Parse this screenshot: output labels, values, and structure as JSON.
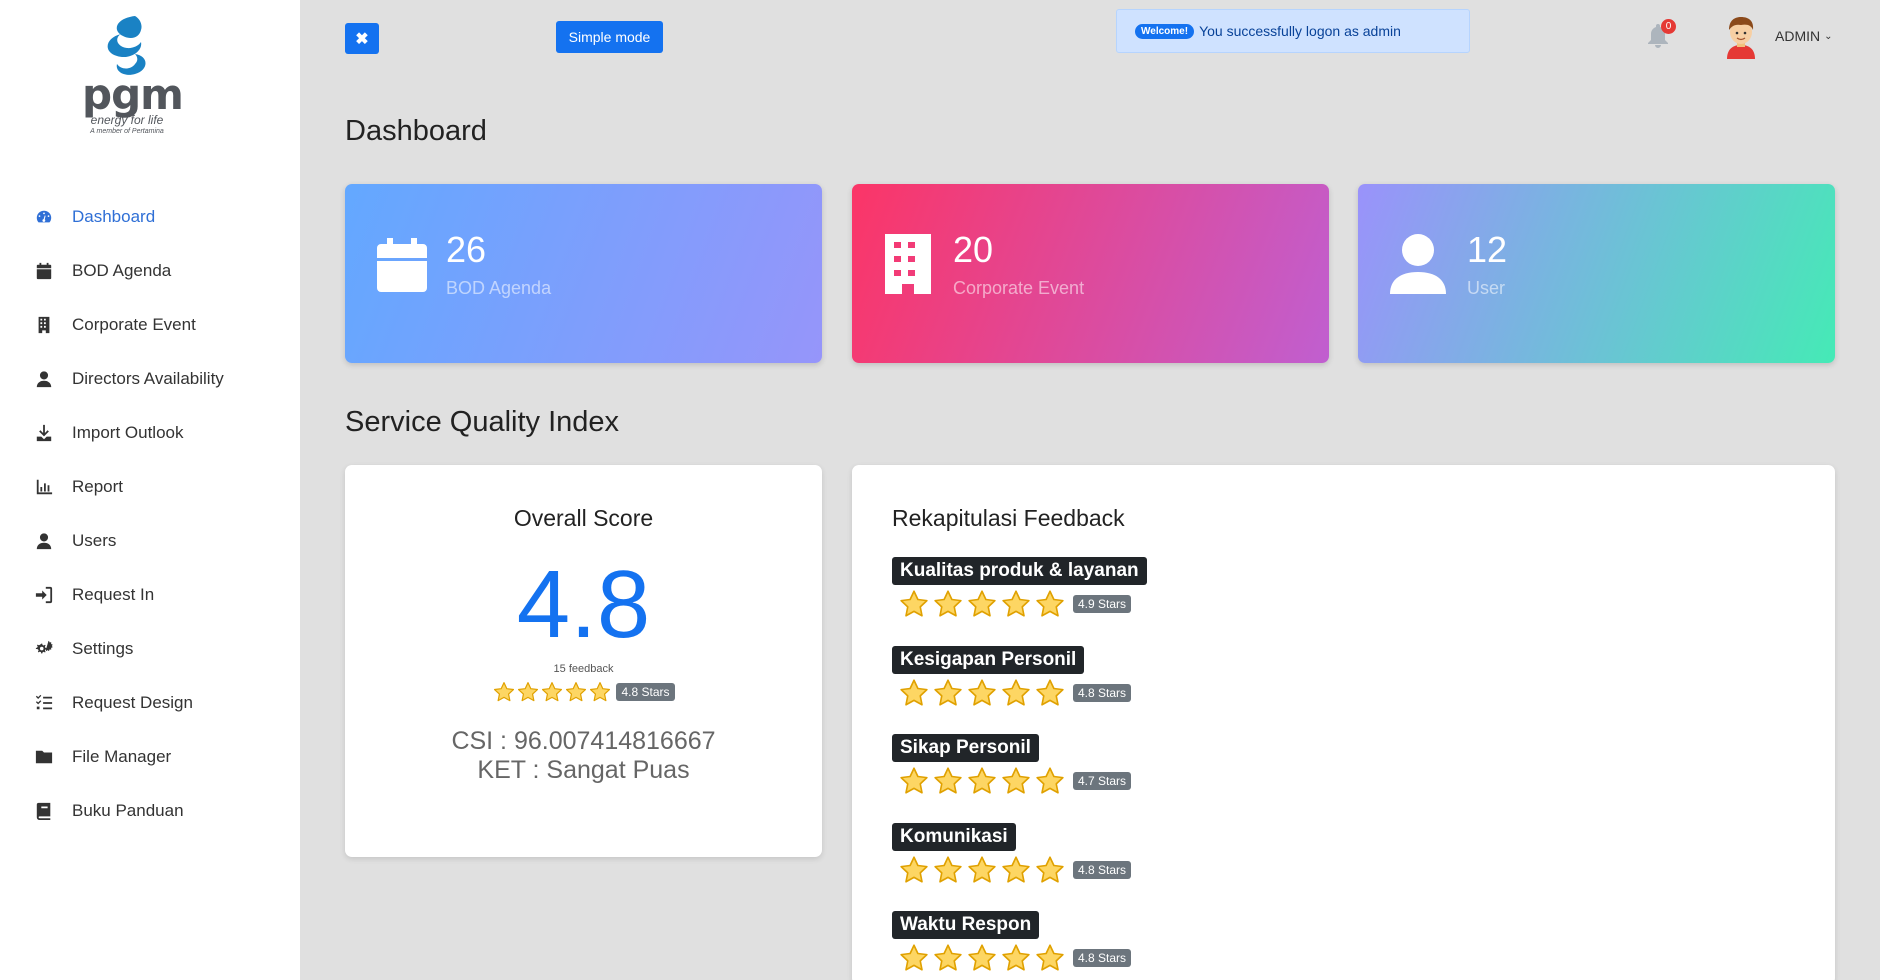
{
  "brand": {
    "name": "pgm",
    "tagline": "energy for life",
    "subline": "A member of Pertamina"
  },
  "sidebar": {
    "items": [
      {
        "label": "Dashboard",
        "icon": "tachometer-icon",
        "active": true
      },
      {
        "label": "BOD Agenda",
        "icon": "calendar-icon"
      },
      {
        "label": "Corporate Event",
        "icon": "building-icon"
      },
      {
        "label": "Directors Availability",
        "icon": "user-icon"
      },
      {
        "label": "Import Outlook",
        "icon": "download-icon"
      },
      {
        "label": "Report",
        "icon": "bar-chart-icon"
      },
      {
        "label": "Users",
        "icon": "user-icon"
      },
      {
        "label": "Request In",
        "icon": "sign-in-icon"
      },
      {
        "label": "Settings",
        "icon": "cogs-icon"
      },
      {
        "label": "Request Design",
        "icon": "list-check-icon"
      },
      {
        "label": "File Manager",
        "icon": "folder-icon"
      },
      {
        "label": "Buku Panduan",
        "icon": "book-icon"
      }
    ]
  },
  "topbar": {
    "close_label": "✖",
    "simple_mode_label": "Simple mode",
    "alert": {
      "badge": "Welcome!",
      "message": "You successfully logon as admin"
    },
    "notification_count": "0",
    "user_label": "ADMIN"
  },
  "page": {
    "title": "Dashboard",
    "stats": [
      {
        "value": "26",
        "label": "BOD Agenda",
        "icon": "calendar-icon"
      },
      {
        "value": "20",
        "label": "Corporate Event",
        "icon": "building-icon"
      },
      {
        "value": "12",
        "label": "User",
        "icon": "user-icon"
      }
    ],
    "section_title": "Service Quality Index",
    "overall": {
      "heading": "Overall Score",
      "score": "4.8",
      "feedback_count": "15 feedback",
      "stars_rating": 4.8,
      "stars_label": "4.8 Stars",
      "csi": "CSI : 96.007414816667",
      "ket": "KET : Sangat Puas"
    },
    "recap": {
      "heading": "Rekapitulasi Feedback",
      "items": [
        {
          "label": "Kualitas produk & layanan",
          "rating": 4.9,
          "stars_label": "4.9 Stars"
        },
        {
          "label": "Kesigapan Personil",
          "rating": 4.8,
          "stars_label": "4.8 Stars"
        },
        {
          "label": "Sikap Personil",
          "rating": 4.7,
          "stars_label": "4.7 Stars"
        },
        {
          "label": "Komunikasi",
          "rating": 4.8,
          "stars_label": "4.8 Stars"
        },
        {
          "label": "Waktu Respon",
          "rating": 4.8,
          "stars_label": "4.8 Stars"
        }
      ]
    }
  },
  "colors": {
    "accent": "#1472f0",
    "star_fill": "#fdd663",
    "star_stroke": "#e0a100"
  }
}
